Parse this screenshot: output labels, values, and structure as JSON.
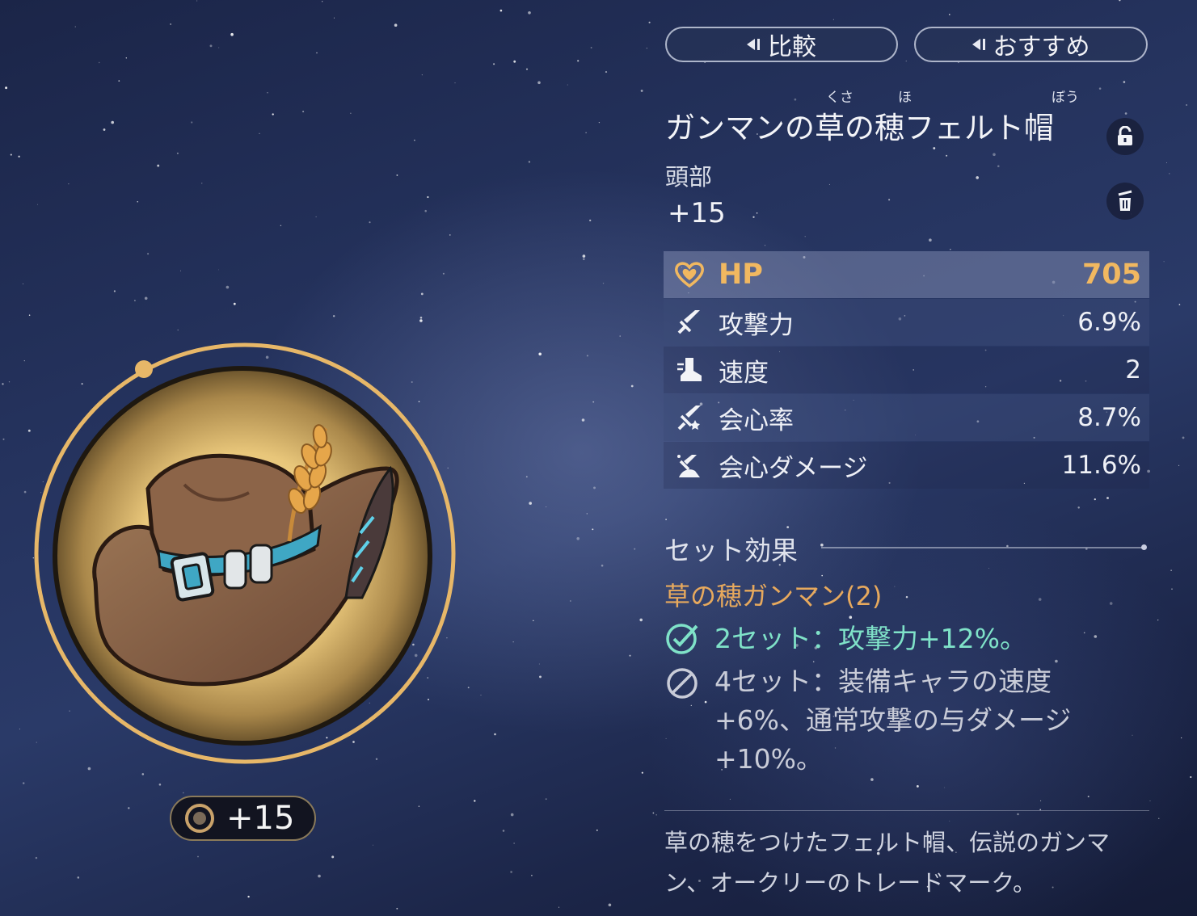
{
  "colors": {
    "accent_gold": "#f1b860",
    "set_name": "#e7a95d",
    "active_effect": "#7fe2c8",
    "inactive_effect": "#c9ccd8",
    "background": "#25335e"
  },
  "top_buttons": {
    "compare_label": "比較",
    "recommend_label": "おすすめ",
    "icon": "back-triangle-icon"
  },
  "item": {
    "name": "ガンマンの草の穂フェルト帽",
    "ruby": {
      "kusa": "くさ",
      "ho": "ほ",
      "bou": "ぼう"
    },
    "slot": "頭部",
    "level": "+15",
    "badge_level": "+15",
    "lock_icon": "lock-icon",
    "trash_icon": "trash-icon",
    "portrait_icon": "cowboy-hat-icon"
  },
  "stats": [
    {
      "name": "HP",
      "value": "705",
      "icon": "heart-icon",
      "main": true
    },
    {
      "name": "攻撃力",
      "value": "6.9%",
      "icon": "sword-icon"
    },
    {
      "name": "速度",
      "value": "2",
      "icon": "boot-icon"
    },
    {
      "name": "会心率",
      "value": "8.7%",
      "icon": "crit-rate-icon"
    },
    {
      "name": "会心ダメージ",
      "value": "11.6%",
      "icon": "crit-damage-icon"
    }
  ],
  "set_effect": {
    "header": "セット効果",
    "set_name": "草の穂ガンマン(2)",
    "effects": [
      {
        "text": "2セット：攻撃力+12%。",
        "active": true,
        "icon": "check-circle-icon"
      },
      {
        "text": "4セット：装備キャラの速度+6%、通常攻撃の与ダメージ+10%。",
        "active": false,
        "icon": "prohibited-icon"
      }
    ]
  },
  "description": "草の穂をつけたフェルト帽、伝説のガンマン、オークリーのトレードマーク。"
}
